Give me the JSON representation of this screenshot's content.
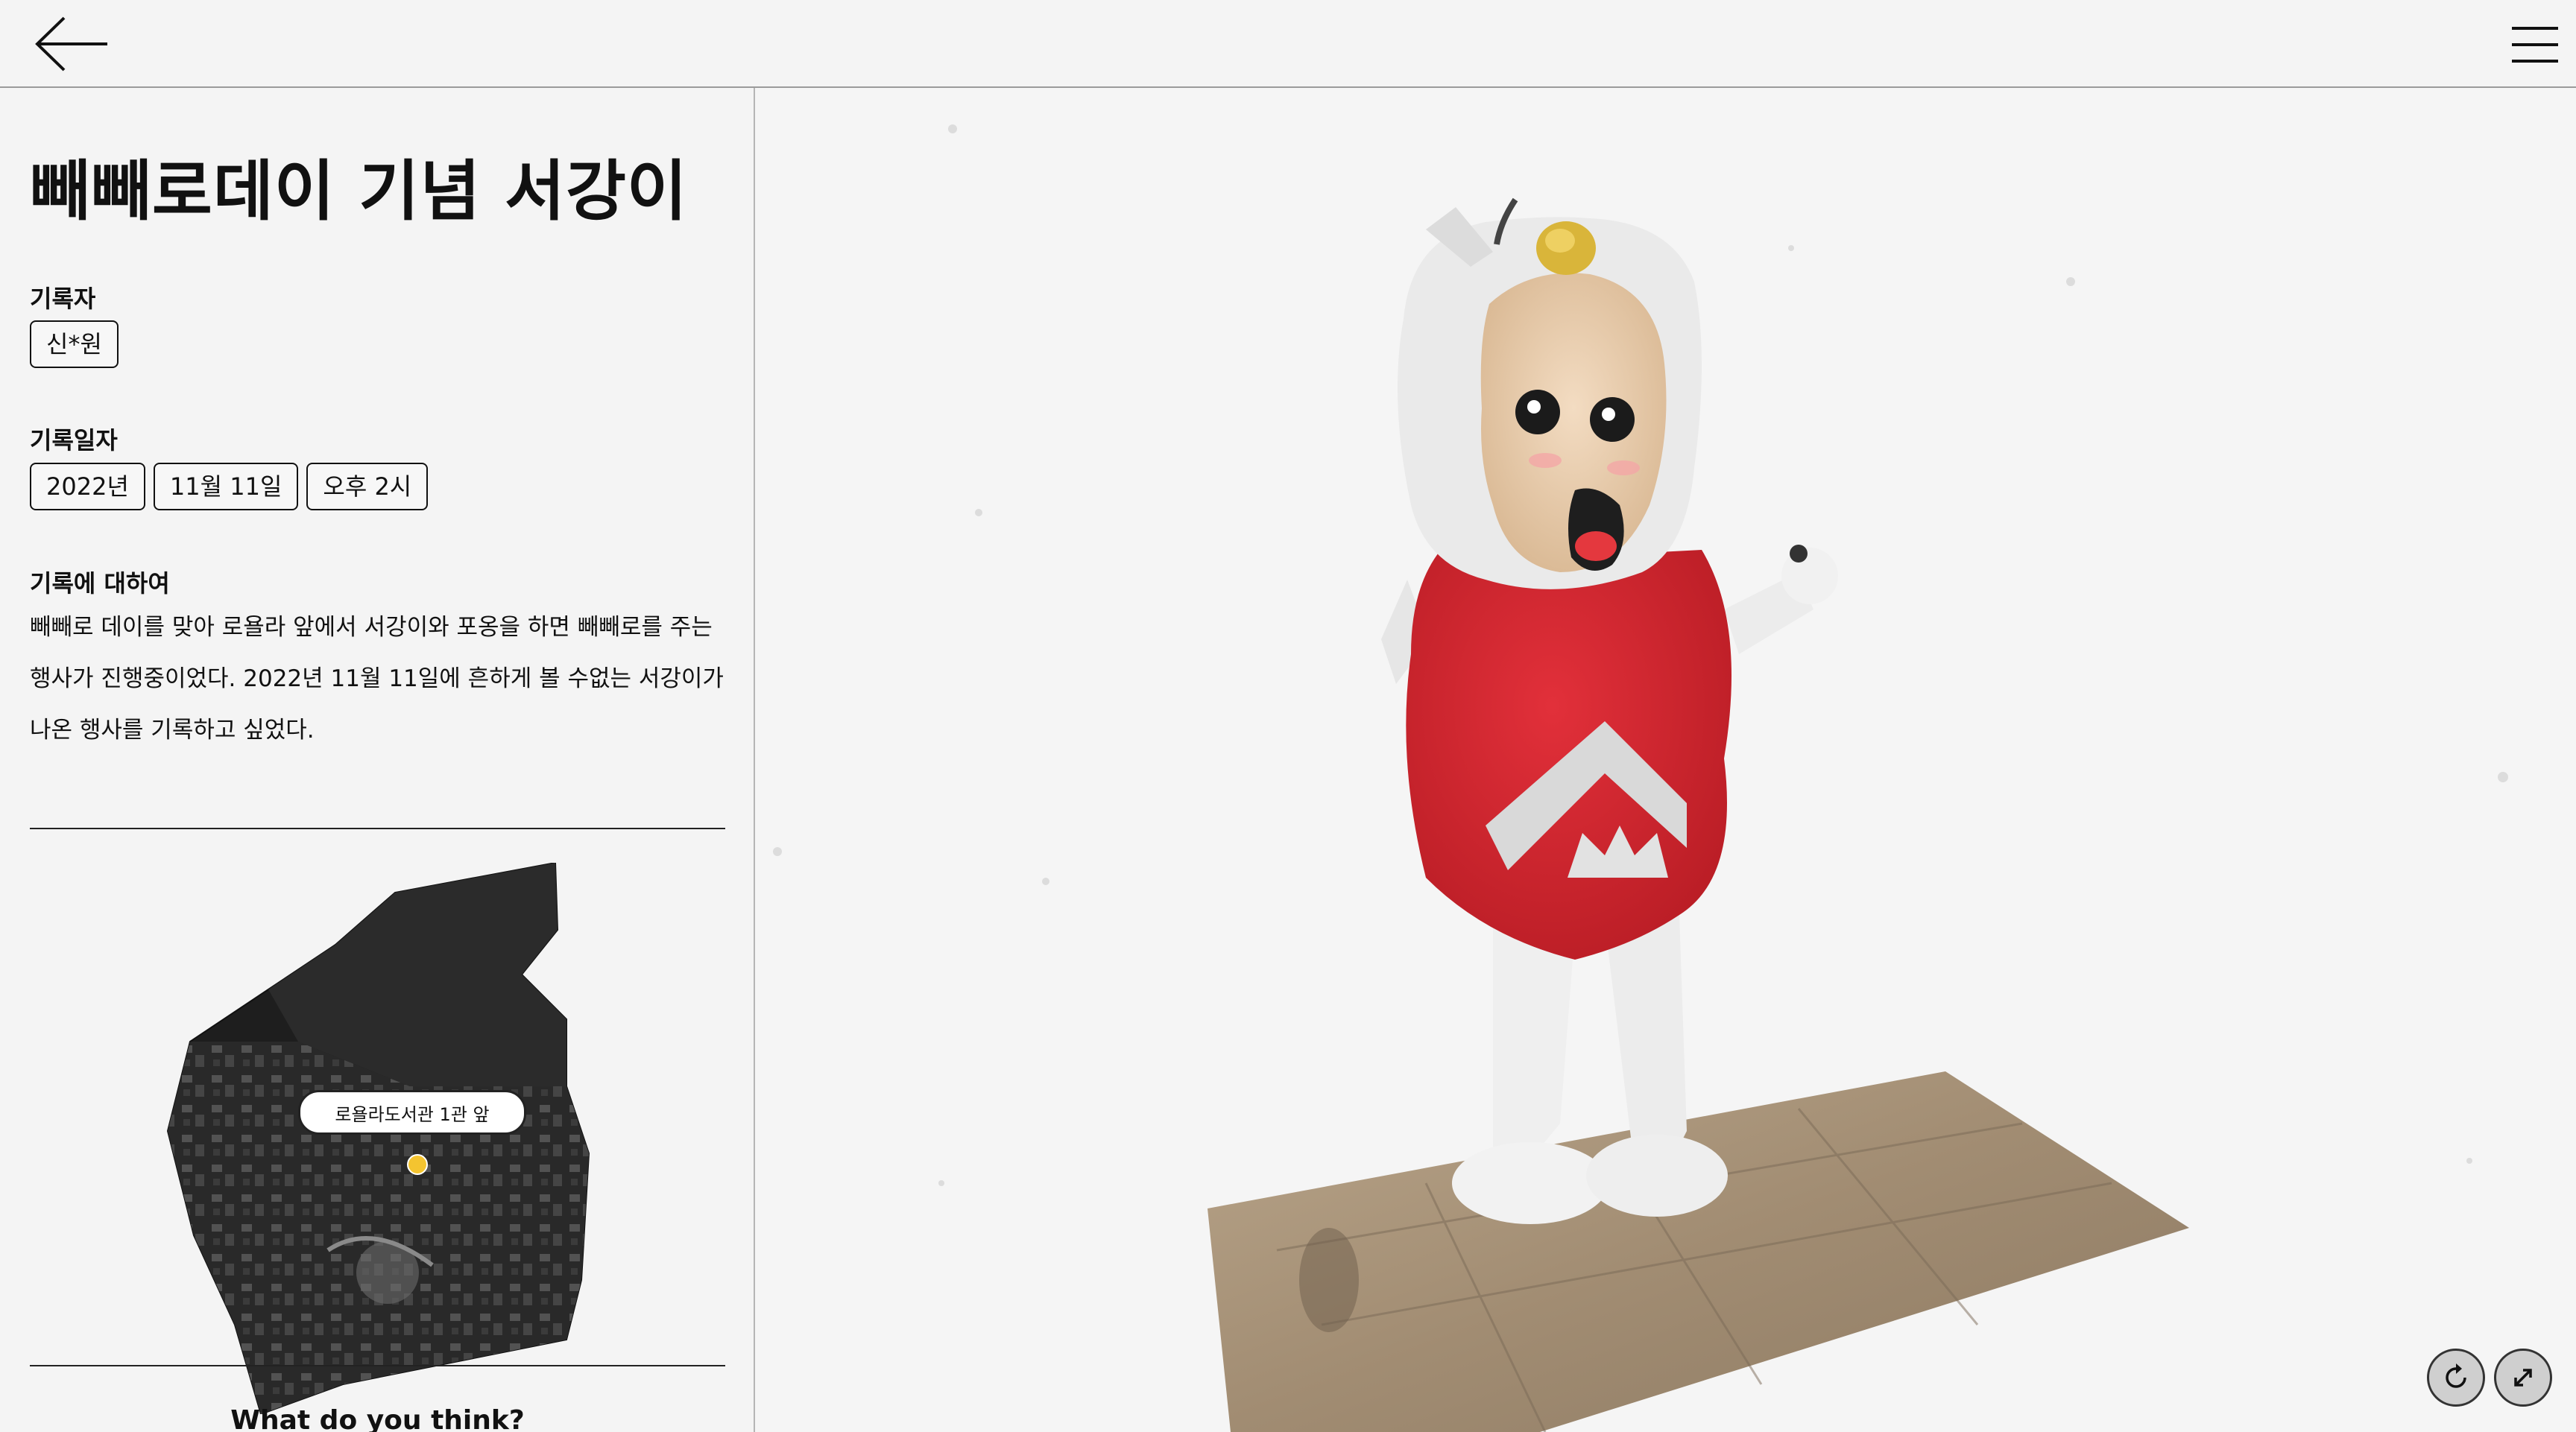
{
  "header": {
    "back_icon": "arrow-left-icon",
    "menu_icon": "hamburger-menu-icon"
  },
  "record": {
    "title": "빼빼로데이 기념 서강이",
    "recorder_label": "기록자",
    "recorder_name": "신*원",
    "date_label": "기록일자",
    "date_chips": [
      "2022년",
      "11월 11일",
      "오후 2시"
    ],
    "about_label": "기록에 대하여",
    "about_text": "빼빼로 데이를 맞아 로욜라 앞에서 서강이와 포옹을 하면 빼빼로를 주는 행사가 진행중이었다. 2022년 11월 11일에 흔하게 볼 수없는 서강이가 나온 행사를 기록하고 싶었다."
  },
  "map": {
    "location_label": "로욜라도서관 1관 앞",
    "marker_color": "#f4c430"
  },
  "feedback": {
    "prompt": "What do you think?"
  },
  "viewer": {
    "rotate_icon": "rotate-icon",
    "fullscreen_icon": "expand-icon"
  },
  "colors": {
    "background": "#f4f4f4",
    "mascot_red": "#d8242c",
    "accent_yellow": "#f4c430"
  }
}
